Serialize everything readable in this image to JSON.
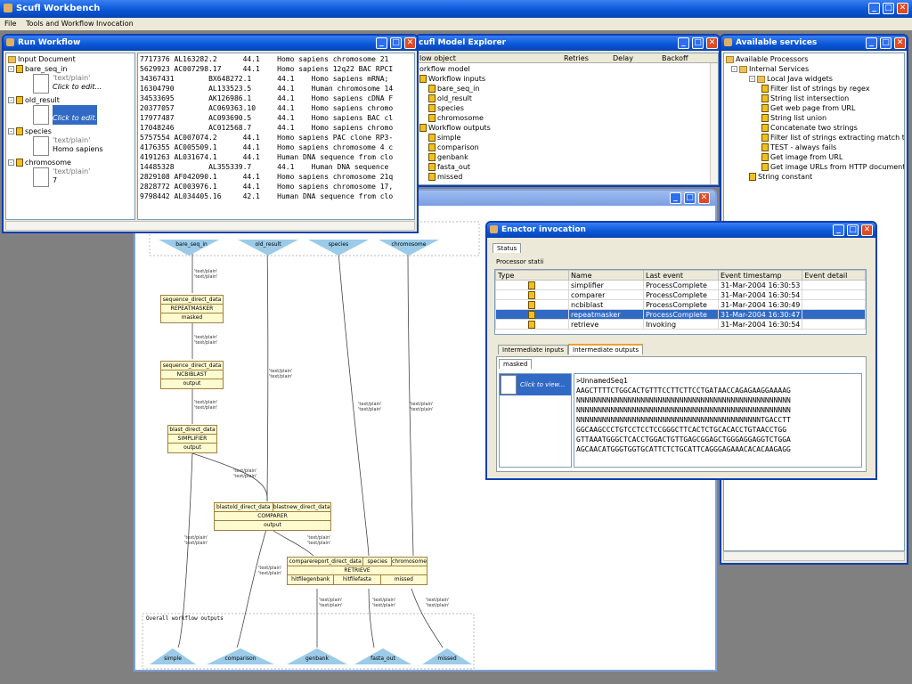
{
  "app": {
    "title": "Scufl Workbench",
    "menu": [
      "File",
      "Tools and Workflow Invocation"
    ]
  },
  "run_workflow": {
    "title": "Run Workflow",
    "root": "Input Document",
    "inputs": [
      {
        "name": "bare_seq_in",
        "type": "'text/plain'",
        "value": "Click to edit..."
      },
      {
        "name": "old_result",
        "type": "",
        "value": "Click to edit..."
      },
      {
        "name": "species",
        "type": "'text/plain'",
        "value": "Homo sapiens"
      },
      {
        "name": "chromosome",
        "type": "'text/plain'",
        "value": "7"
      }
    ],
    "rows": [
      "7717376 AL163282.2      44.1    Homo sapiens chromosome 21",
      "5629923 AC007298.17     44.1    Homo sapiens 12q22 BAC RPCI",
      "34367431        BX648272.1      44.1    Homo sapiens mRNA;",
      "16304790        AL133523.5      44.1    Human chromosome 14",
      "34533695        AK126986.1      44.1    Homo sapiens cDNA F",
      "20377057        AC069363.10     44.1    Homo sapiens chromo",
      "17977487        AC093690.5      44.1    Homo sapiens BAC cl",
      "17048246        AC012568.7      44.1    Homo sapiens chromo",
      "5757554 AC007074.2      44.1    Homo sapiens PAC clone RP3-",
      "4176355 AC005509.1      44.1    Homo sapiens chromosome 4 c",
      "4191263 AL031674.1      44.1    Human DNA sequence from clo",
      "14485328        AL355339.7      44.1    Human DNA sequence",
      "2829108 AF042090.1      44.1    Homo sapiens chromosome 21q",
      "2828772 AC003976.1      44.1    Homo sapiens chromosome 17,",
      "9798442 AL034405.16     42.1    Human DNA sequence from clo"
    ]
  },
  "model_explorer": {
    "title": "cufl Model Explorer",
    "columns": [
      "low object",
      "Retries",
      "Delay",
      "Backoff"
    ],
    "items": [
      "orkflow model",
      "Workflow inputs",
      "bare_seq_in",
      "old_result",
      "species",
      "chromosome",
      "Workflow outputs",
      "simple",
      "comparison",
      "genbank",
      "fasta_out",
      "missed"
    ]
  },
  "services": {
    "title": "Available services",
    "items": [
      "Available Processors",
      "Internal Services",
      "Local Java widgets",
      "Filter list of strings by regex",
      "String list intersection",
      "Get web page from URL",
      "String list union",
      "Concatenate two strings",
      "Filter list of strings extracting match to a reg",
      "TEST - always fails",
      "Get image from URL",
      "Get image URLs from HTTP document",
      "String constant"
    ]
  },
  "enactor": {
    "title": "Enactor invocation",
    "tab": "Status",
    "group": "Processor statii",
    "columns": [
      "Type",
      "Name",
      "Last event",
      "Event timestamp",
      "Event detail"
    ],
    "rows": [
      [
        "",
        "simplifier",
        "ProcessComplete",
        "31-Mar-2004 16:30:53",
        ""
      ],
      [
        "",
        "comparer",
        "ProcessComplete",
        "31-Mar-2004 16:30:54",
        ""
      ],
      [
        "",
        "ncbiblast",
        "ProcessComplete",
        "31-Mar-2004 16:30:49",
        ""
      ],
      [
        "",
        "repeatmasker",
        "ProcessComplete",
        "31-Mar-2004 16:30:47",
        ""
      ],
      [
        "",
        "retrieve",
        "Invoking",
        "31-Mar-2004 16:30:54",
        ""
      ]
    ],
    "tabs": [
      "Intermediate inputs",
      "Intermediate outputs"
    ],
    "subtab": "masked",
    "doc_label": "Click to view...",
    "seq": [
      ">UnnamedSeq1",
      "AAGCTTTTCTGGCACTGTTTCCTTCTTCCTGATAACCAGAGAAGGAAAAG",
      "NNNNNNNNNNNNNNNNNNNNNNNNNNNNNNNNNNNNNNNNNNNNNNNNNN",
      "NNNNNNNNNNNNNNNNNNNNNNNNNNNNNNNNNNNNNNNNNNNNNNNNNN",
      "NNNNNNNNNNNNNNNNNNNNNNNNNNNNNNNNNNNNNNNNNNNTGACCTT",
      "GGCAAGCCCTGTCCTCCTCCGGGCTTCACTCTGCACACCTGTAACCTGG",
      "GTTAAATGGGCTCACCTGGACTGTTGAGCGGAGCTGGGAGGAGGTCTGGA",
      "AGCAACATGGGTGGTGCATTCTCTGCATTCAGGGAGAAACACACAAGAGG"
    ]
  },
  "diagram": {
    "inputs": [
      "bare_seq_in",
      "old_result",
      "species",
      "chromosome"
    ],
    "mime": "'text/plain'",
    "repeat": [
      "sequence_direct_data",
      "REPEATMASKER",
      "masked"
    ],
    "ncbi": [
      "sequence_direct_data",
      "NCBIBLAST",
      "output"
    ],
    "simp": [
      "blast_direct_data",
      "SIMPLIFIER",
      "output"
    ],
    "comp_in": [
      "blastold_direct_data",
      "blastnew_direct_data"
    ],
    "comp": [
      "COMPARER",
      "output"
    ],
    "retr_in": [
      "comparereport_direct_data",
      "species",
      "chromosome"
    ],
    "retr": "RETRIEVE",
    "retr_out": [
      "hitfilegenbank",
      "hitfilefasta",
      "missed"
    ],
    "outputs_label": "Overall workflow outputs",
    "outputs": [
      "simple",
      "comparison",
      "genbank",
      "fasta_out",
      "missed"
    ]
  }
}
